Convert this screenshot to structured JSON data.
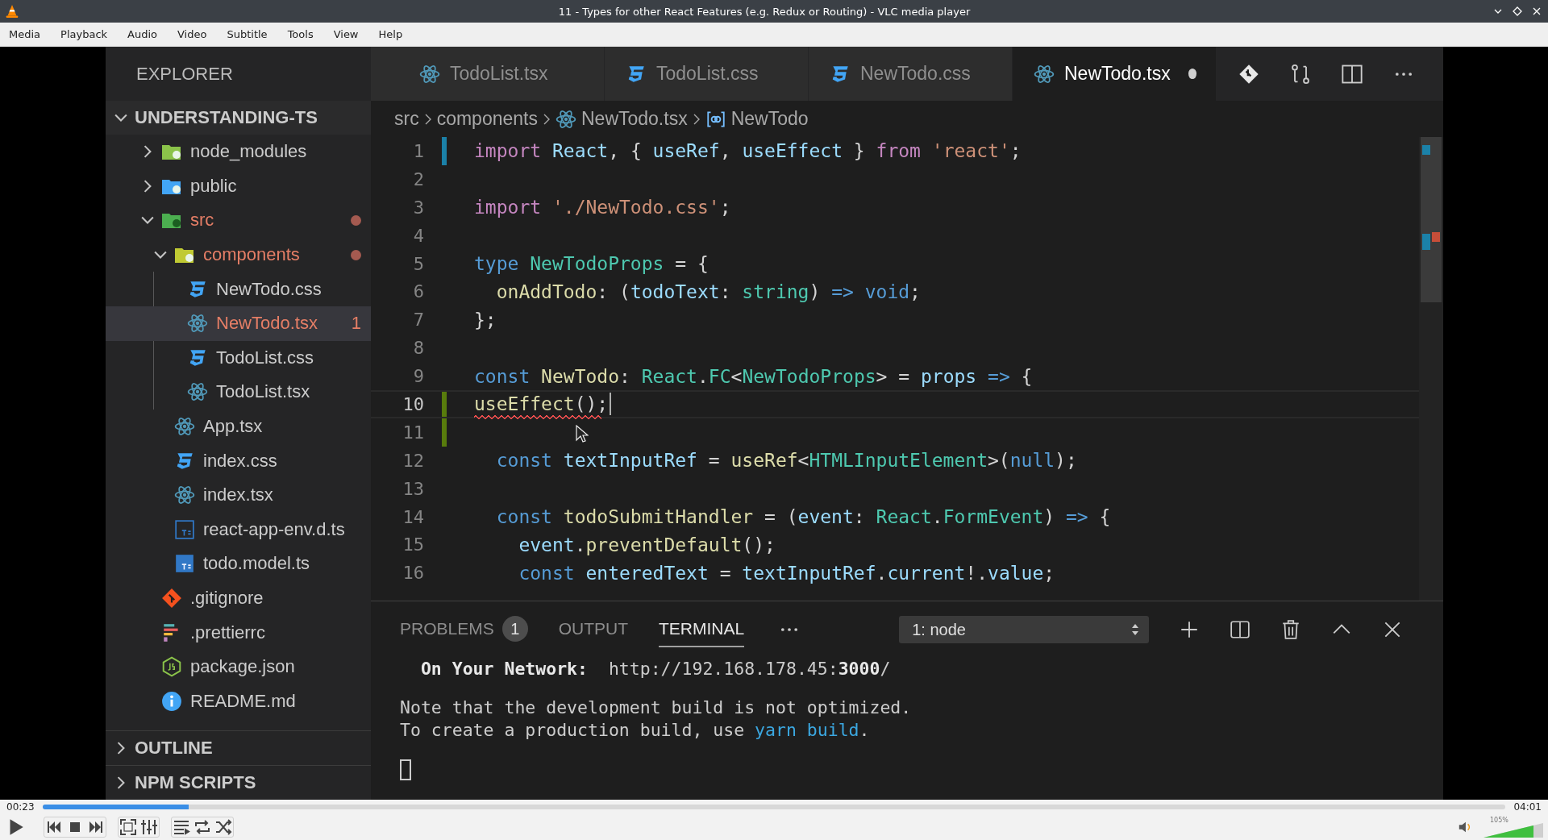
{
  "window": {
    "title": "11 - Types for other React Features (e.g. Redux or Routing) - VLC media player"
  },
  "menu": [
    "Media",
    "Playback",
    "Audio",
    "Video",
    "Subtitle",
    "Tools",
    "View",
    "Help"
  ],
  "video": {
    "tabs": [
      {
        "label": "TodoList.tsx",
        "kind": "react",
        "selected": false,
        "dirty": false
      },
      {
        "label": "TodoList.css",
        "kind": "css",
        "selected": false,
        "dirty": false
      },
      {
        "label": "NewTodo.css",
        "kind": "css",
        "selected": false,
        "dirty": false
      },
      {
        "label": "NewTodo.tsx",
        "kind": "react",
        "selected": true,
        "dirty": true
      }
    ],
    "explorer": {
      "title": "EXPLORER",
      "project": {
        "label": "UNDERSTANDING-TS",
        "expanded": true
      },
      "tree": [
        {
          "label": "node_modules",
          "kind": "folder-node",
          "expanded": false,
          "selected": false,
          "error": false,
          "modified": false
        },
        {
          "label": "public",
          "kind": "folder-public",
          "expanded": false,
          "selected": false,
          "error": false,
          "modified": false
        },
        {
          "label": "src",
          "kind": "folder-src",
          "expanded": true,
          "selected": false,
          "error": true,
          "modified": true,
          "children": [
            {
              "label": "components",
              "kind": "folder-components",
              "expanded": true,
              "selected": false,
              "error": true,
              "modified": true,
              "children": [
                {
                  "label": "NewTodo.css",
                  "kind": "css",
                  "selected": false,
                  "error": false,
                  "modified": false
                },
                {
                  "label": "NewTodo.tsx",
                  "kind": "react",
                  "selected": true,
                  "error": true,
                  "modified": false,
                  "badge": "1"
                },
                {
                  "label": "TodoList.css",
                  "kind": "css",
                  "selected": false,
                  "error": false,
                  "modified": false
                },
                {
                  "label": "TodoList.tsx",
                  "kind": "react",
                  "selected": false,
                  "error": false,
                  "modified": false
                }
              ]
            },
            {
              "label": "App.tsx",
              "kind": "react",
              "selected": false,
              "error": false,
              "modified": false
            },
            {
              "label": "index.css",
              "kind": "css",
              "selected": false,
              "error": false,
              "modified": false
            },
            {
              "label": "index.tsx",
              "kind": "react",
              "selected": false,
              "error": false,
              "modified": false
            },
            {
              "label": "react-app-env.d.ts",
              "kind": "ts-outline",
              "selected": false,
              "error": false,
              "modified": false
            },
            {
              "label": "todo.model.ts",
              "kind": "ts",
              "selected": false,
              "error": false,
              "modified": false
            }
          ]
        },
        {
          "label": ".gitignore",
          "kind": "git",
          "selected": false,
          "error": false,
          "modified": false
        },
        {
          "label": ".prettierrc",
          "kind": "prettier",
          "selected": false,
          "error": false,
          "modified": false
        },
        {
          "label": "package.json",
          "kind": "json",
          "selected": false,
          "error": false,
          "modified": false
        },
        {
          "label": "README.md",
          "kind": "info",
          "selected": false,
          "error": false,
          "modified": false
        }
      ],
      "sections": [
        {
          "label": "OUTLINE",
          "expanded": false
        },
        {
          "label": "NPM SCRIPTS",
          "expanded": false
        }
      ]
    },
    "breadcrumb": [
      {
        "label": "src",
        "kind": "plain"
      },
      {
        "label": "components",
        "kind": "plain"
      },
      {
        "label": "NewTodo.tsx",
        "kind": "react"
      },
      {
        "label": "NewTodo",
        "kind": "symbol"
      }
    ],
    "code": [
      {
        "number": "1",
        "kind": "modified",
        "current": false,
        "error": false,
        "tokens": [
          {
            "text": "import ",
            "kind": "kw"
          },
          {
            "text": "React",
            "kind": "var"
          },
          {
            "text": ", { ",
            "kind": "pun"
          },
          {
            "text": "useRef",
            "kind": "var"
          },
          {
            "text": ", ",
            "kind": "pun"
          },
          {
            "text": "useEffect",
            "kind": "var"
          },
          {
            "text": " } ",
            "kind": "pun"
          },
          {
            "text": "from ",
            "kind": "kw"
          },
          {
            "text": "'react'",
            "kind": "str"
          },
          {
            "text": ";",
            "kind": "pun"
          }
        ]
      },
      {
        "number": "2",
        "current": false,
        "error": false
      },
      {
        "number": "3",
        "current": false,
        "error": false,
        "tokens": [
          {
            "text": "import ",
            "kind": "kw"
          },
          {
            "text": "'./NewTodo.css'",
            "kind": "str"
          },
          {
            "text": ";",
            "kind": "pun"
          }
        ]
      },
      {
        "number": "4",
        "current": false,
        "error": false
      },
      {
        "number": "5",
        "current": false,
        "error": false,
        "tokens": [
          {
            "text": "type ",
            "kind": "st"
          },
          {
            "text": "NewTodoProps",
            "kind": "ty"
          },
          {
            "text": " = {",
            "kind": "pun"
          }
        ]
      },
      {
        "number": "6",
        "current": false,
        "error": false,
        "tokens": [
          {
            "text": "  onAddTodo",
            "kind": "fn"
          },
          {
            "text": ": (",
            "kind": "pun"
          },
          {
            "text": "todoText",
            "kind": "var"
          },
          {
            "text": ": ",
            "kind": "pun"
          },
          {
            "text": "string",
            "kind": "ty"
          },
          {
            "text": ") ",
            "kind": "pun"
          },
          {
            "text": "=> ",
            "kind": "st"
          },
          {
            "text": "void",
            "kind": "st"
          },
          {
            "text": ";",
            "kind": "pun"
          }
        ]
      },
      {
        "number": "7",
        "current": false,
        "error": false,
        "tokens": [
          {
            "text": "};",
            "kind": "pun"
          }
        ]
      },
      {
        "number": "8",
        "current": false,
        "error": false
      },
      {
        "number": "9",
        "current": false,
        "error": false,
        "tokens": [
          {
            "text": "const ",
            "kind": "st"
          },
          {
            "text": "NewTodo",
            "kind": "fn"
          },
          {
            "text": ": ",
            "kind": "pun"
          },
          {
            "text": "React",
            "kind": "ty"
          },
          {
            "text": ".",
            "kind": "pun"
          },
          {
            "text": "FC",
            "kind": "ty"
          },
          {
            "text": "<",
            "kind": "pun"
          },
          {
            "text": "NewTodoProps",
            "kind": "ty"
          },
          {
            "text": "> = ",
            "kind": "pun"
          },
          {
            "text": "props ",
            "kind": "var"
          },
          {
            "text": "=>",
            "kind": "st"
          },
          {
            "text": " {",
            "kind": "pun"
          }
        ]
      },
      {
        "number": "10",
        "kind": "added",
        "current": true,
        "error": true,
        "tokens": [
          {
            "text": "useEffect",
            "kind": "fn"
          },
          {
            "text": "();",
            "kind": "pun"
          }
        ]
      },
      {
        "number": "11",
        "kind": "added",
        "current": false,
        "error": false
      },
      {
        "number": "12",
        "current": false,
        "error": false,
        "tokens": [
          {
            "text": "  const ",
            "kind": "st"
          },
          {
            "text": "textInputRef",
            "kind": "var"
          },
          {
            "text": " = ",
            "kind": "pun"
          },
          {
            "text": "useRef",
            "kind": "fn"
          },
          {
            "text": "<",
            "kind": "pun"
          },
          {
            "text": "HTMLInputElement",
            "kind": "ty"
          },
          {
            "text": ">(",
            "kind": "pun"
          },
          {
            "text": "null",
            "kind": "st"
          },
          {
            "text": ");",
            "kind": "pun"
          }
        ]
      },
      {
        "number": "13",
        "current": false,
        "error": false
      },
      {
        "number": "14",
        "current": false,
        "error": false,
        "tokens": [
          {
            "text": "  const ",
            "kind": "st"
          },
          {
            "text": "todoSubmitHandler",
            "kind": "fn"
          },
          {
            "text": " = (",
            "kind": "pun"
          },
          {
            "text": "event",
            "kind": "var"
          },
          {
            "text": ": ",
            "kind": "pun"
          },
          {
            "text": "React",
            "kind": "ty"
          },
          {
            "text": ".",
            "kind": "pun"
          },
          {
            "text": "FormEvent",
            "kind": "ty"
          },
          {
            "text": ") ",
            "kind": "pun"
          },
          {
            "text": "=>",
            "kind": "st"
          },
          {
            "text": " {",
            "kind": "pun"
          }
        ]
      },
      {
        "number": "15",
        "current": false,
        "error": false,
        "tokens": [
          {
            "text": "    event",
            "kind": "var"
          },
          {
            "text": ".",
            "kind": "pun"
          },
          {
            "text": "preventDefault",
            "kind": "fn"
          },
          {
            "text": "();",
            "kind": "pun"
          }
        ]
      },
      {
        "number": "16",
        "current": false,
        "error": false,
        "tokens": [
          {
            "text": "    const ",
            "kind": "st"
          },
          {
            "text": "enteredText",
            "kind": "var"
          },
          {
            "text": " = ",
            "kind": "pun"
          },
          {
            "text": "textInputRef",
            "kind": "var"
          },
          {
            "text": ".",
            "kind": "pun"
          },
          {
            "text": "current",
            "kind": "var"
          },
          {
            "text": "!.",
            "kind": "pun"
          },
          {
            "text": "value",
            "kind": "var"
          },
          {
            "text": ";",
            "kind": "pun"
          }
        ]
      }
    ],
    "panel": {
      "tabs": [
        {
          "label": "PROBLEMS",
          "badge": "1",
          "selected": false
        },
        {
          "label": "OUTPUT",
          "selected": false
        },
        {
          "label": "TERMINAL",
          "selected": true
        }
      ],
      "terminal_select": "1: node",
      "blocks": [
        {
          "lines": [
            [
              {
                "text": "  On Your Network:",
                "kind": "bold"
              },
              {
                "text": "  http://192.168.178.45:",
                "kind": "plain"
              },
              {
                "text": "3000",
                "kind": "bold"
              },
              {
                "text": "/",
                "kind": "plain"
              }
            ]
          ]
        },
        {
          "lines": [
            [
              {
                "text": "Note that the development build is not optimized.",
                "kind": "plain"
              }
            ],
            [
              {
                "text": "To create a production build, use ",
                "kind": "plain"
              },
              {
                "text": "yarn build",
                "kind": "link"
              },
              {
                "text": ".",
                "kind": "plain"
              }
            ]
          ]
        }
      ]
    }
  },
  "player": {
    "elapsed": "00:23",
    "seek": {
      "level": 0.1
    },
    "total": "04:01",
    "volume": {
      "reading": "105%",
      "level": 0.84
    }
  }
}
